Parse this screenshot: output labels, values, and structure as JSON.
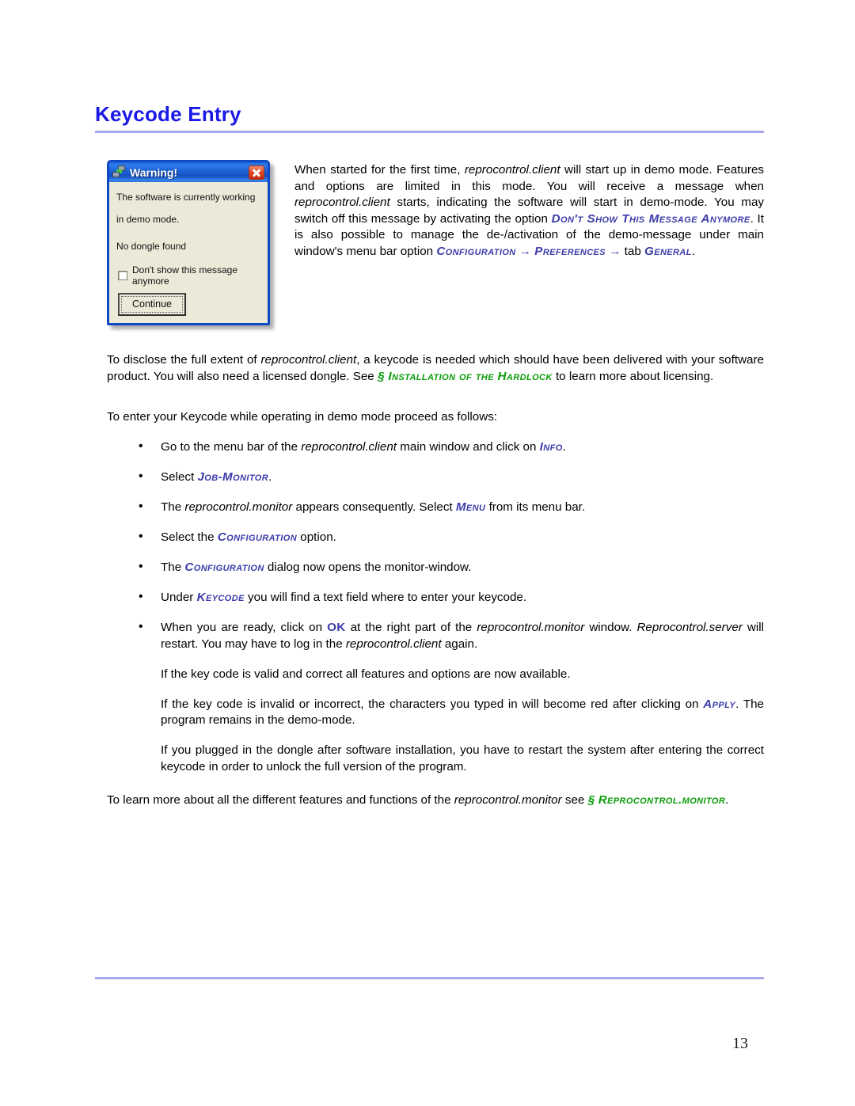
{
  "page": {
    "title": "Keycode Entry",
    "number": "13"
  },
  "dialog": {
    "icon": "network-computers-icon",
    "title": "Warning!",
    "close_label": "close-icon",
    "message_line1": "The software is currently working",
    "message_line2": "in demo mode.",
    "message_line3": "No dongle found",
    "checkbox_label": "Don't show this message anymore",
    "checkbox_checked": false,
    "button_label": "Continue"
  },
  "intro_paragraph": {
    "t1": "When started for the first time, ",
    "i1": "reprocontrol.client",
    "t2": " will start up in demo mode. Features and options are limited in this mode.  You will receive a message when ",
    "i2": "reprocontrol.client",
    "t3": " starts, indicating the software will start in demo-mode. You may switch off this message by activating the option ",
    "r1": "Don't Show This Message Anymore",
    "t4": ".  It is also possible to manage the de-/activation of the demo-message under main window's menu bar option ",
    "r2": "Configuration",
    "arrow1": "→",
    "r3": "Preferences",
    "arrow2": "→",
    "t5": " tab ",
    "r4": "General",
    "t6": "."
  },
  "disclose_paragraph": {
    "t1": "To disclose the full extent of ",
    "i1": "reprocontrol.client",
    "t2": ", a keycode is needed which should have been delivered with your software product. You will also need a licensed dongle. See ",
    "g1": "§ Installation of the Hardlock",
    "t3": " to learn more about licensing."
  },
  "enter_paragraph": {
    "text": "To enter your Keycode while operating in demo mode proceed as follows:"
  },
  "bullets": [
    {
      "t1": "Go to the menu bar of the ",
      "i1": "reprocontrol.client",
      "t2": " main window and click on ",
      "r1": "Info",
      "t3": "."
    },
    {
      "t1": "Select ",
      "r1": "Job-Monitor",
      "t2": "."
    },
    {
      "t1": "The ",
      "i1": "reprocontrol.monitor",
      "t2": " appears consequently. Select ",
      "r1": "Menu",
      "t3": " from its menu bar."
    },
    {
      "t1": "Select the ",
      "r1": "Configuration",
      "t2": " option."
    },
    {
      "t1": "The ",
      "r1": "Configuration",
      "t2": " dialog now opens the monitor-window."
    },
    {
      "t1": "Under ",
      "r1": "Keycode",
      "t2": " you will find a text field where to enter your keycode."
    },
    {
      "t1": "When you are ready, click on ",
      "ok": "OK",
      "t2": " at the right part of the ",
      "i1": "reprocontrol.monitor",
      "t3": " window. ",
      "i2": "Reprocontrol.server",
      "t4": " will restart. You may have to log in the ",
      "i3": "reprocontrol.client",
      "t5": " again."
    }
  ],
  "sub_paragraphs": [
    {
      "text": "If the key code is valid and correct all features and options are now available."
    },
    {
      "t1": "If the key code is invalid or incorrect, the characters you typed in will become red after clicking on ",
      "r1": "Apply",
      "t2": ". The program remains in the demo-mode."
    },
    {
      "text": "If you plugged in the dongle after software installation, you have to restart the system after entering the correct keycode in order to unlock the full version of the program."
    }
  ],
  "final_paragraph": {
    "t1": "To learn more about all the different features and functions of the ",
    "i1": "reprocontrol.monitor",
    "t2": " see ",
    "g1": "§",
    "g2": "Reprocontrol.monitor",
    "t3": "."
  },
  "colors": {
    "heading_blue": "#1a1ae6",
    "rule_lavender": "#a9a9ee",
    "reference_blue": "#3b3bab",
    "reference_green": "#0a9d0a",
    "dialog_titlebar_blue": "#1550c2",
    "dialog_face": "#ece9d8"
  }
}
